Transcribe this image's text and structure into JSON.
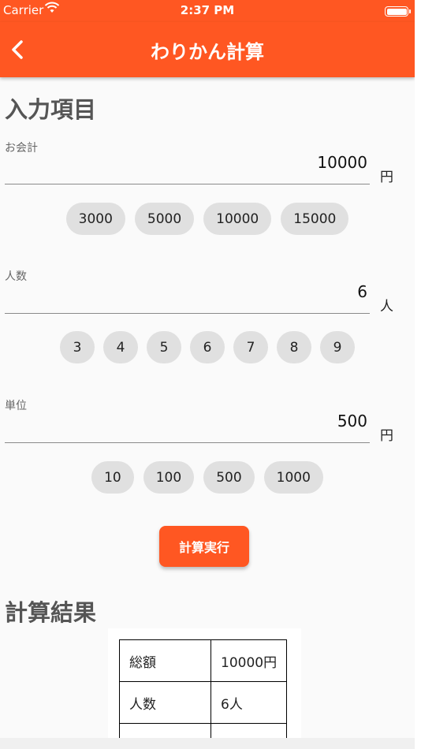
{
  "status_bar": {
    "carrier": "Carrier",
    "time": "2:37 PM"
  },
  "app_bar": {
    "title": "わりかん計算"
  },
  "input_section": {
    "title": "入力項目"
  },
  "amount": {
    "label": "お会計",
    "value": "10000",
    "unit": "円",
    "presets": [
      "3000",
      "5000",
      "10000",
      "15000"
    ]
  },
  "people": {
    "label": "人数",
    "value": "6",
    "unit": "人",
    "presets": [
      "3",
      "4",
      "5",
      "6",
      "7",
      "8",
      "9"
    ]
  },
  "unit_field": {
    "label": "単位",
    "value": "500",
    "unit": "円",
    "presets": [
      "10",
      "100",
      "500",
      "1000"
    ]
  },
  "calculate_button": {
    "label": "計算実行"
  },
  "result_section": {
    "title": "計算結果",
    "rows": [
      {
        "key": "総額",
        "value": "10000円"
      },
      {
        "key": "人数",
        "value": "6人"
      }
    ]
  },
  "colors": {
    "accent": "#ff5722",
    "chip": "#e0e0e0",
    "background": "#fafafa"
  }
}
